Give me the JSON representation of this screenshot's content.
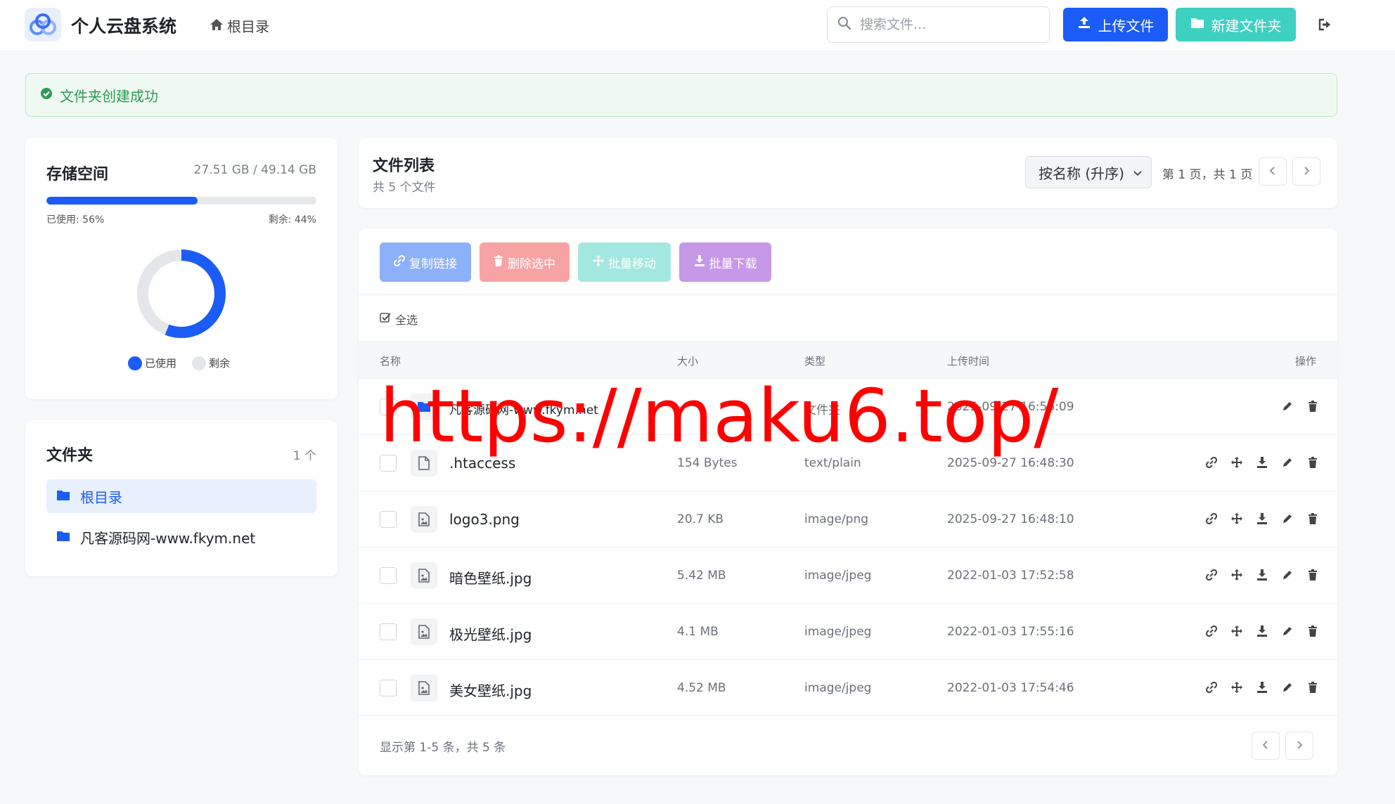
{
  "header": {
    "app_title": "个人云盘系统",
    "breadcrumb": "根目录",
    "search_placeholder": "搜索文件...",
    "upload_label": "上传文件",
    "new_folder_label": "新建文件夹"
  },
  "alert": {
    "message": "文件夹创建成功"
  },
  "storage": {
    "title": "存储空间",
    "amount": "27.51 GB / 49.14 GB",
    "used_label": "已使用: 56%",
    "left_label": "剩余: 44%",
    "used_fraction": 0.56,
    "legend_used": "已使用",
    "legend_left": "剩余"
  },
  "folders": {
    "title": "文件夹",
    "count": "1 个",
    "items": [
      {
        "label": "根目录",
        "active": true
      },
      {
        "label": "凡客源码网-www.fkym.net",
        "active": false
      }
    ]
  },
  "file_list": {
    "title": "文件列表",
    "subtitle": "共 5 个文件",
    "sort_value": "按名称 (升序)",
    "page_info": "第 1 页，共 1 页"
  },
  "toolbar": {
    "copy_link": "复制链接",
    "delete_selected": "删除选中",
    "batch_move": "批量移动",
    "batch_download": "批量下载",
    "select_all": "全选"
  },
  "table": {
    "headers": {
      "name": "名称",
      "size": "大小",
      "type": "类型",
      "time": "上传时间",
      "actions": "操作"
    },
    "rows": [
      {
        "name": "凡客源码网-www.fkym.net",
        "size": "-",
        "type": "文件夹",
        "time": "2025-09-27 16:56:09",
        "kind": "folder"
      },
      {
        "name": ".htaccess",
        "size": "154 Bytes",
        "type": "text/plain",
        "time": "2025-09-27 16:48:30",
        "kind": "file"
      },
      {
        "name": "logo3.png",
        "size": "20.7 KB",
        "type": "image/png",
        "time": "2025-09-27 16:48:10",
        "kind": "image"
      },
      {
        "name": "暗色壁纸.jpg",
        "size": "5.42 MB",
        "type": "image/jpeg",
        "time": "2022-01-03 17:52:58",
        "kind": "image"
      },
      {
        "name": "极光壁纸.jpg",
        "size": "4.1 MB",
        "type": "image/jpeg",
        "time": "2022-01-03 17:55:16",
        "kind": "image"
      },
      {
        "name": "美女壁纸.jpg",
        "size": "4.52 MB",
        "type": "image/jpeg",
        "time": "2022-01-03 17:54:46",
        "kind": "image"
      }
    ],
    "footer": "显示第 1-5 条，共 5 条"
  },
  "watermark": "https://maku6.top/",
  "colors": {
    "primary": "#1a5cf5",
    "teal": "#3ed1c1",
    "success": "#2e9a52"
  }
}
